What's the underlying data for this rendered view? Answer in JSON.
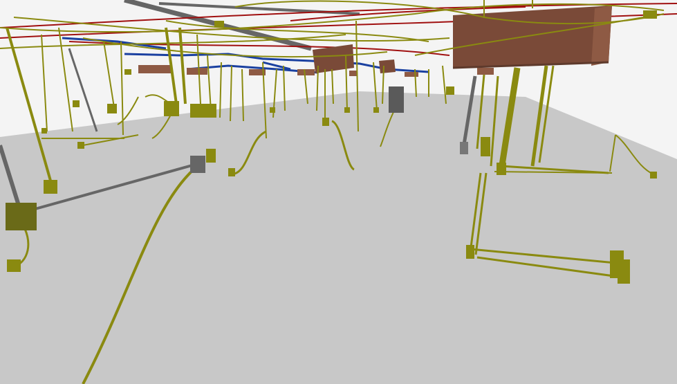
{
  "scene": {
    "description_label": "",
    "colors": {
      "background": "#f4f4f4",
      "floor": "#c8c8c8",
      "conduit": "#8a8a10",
      "conduit_dark": "#5a5a08",
      "conduit_box": "#9a9a14",
      "steel_pipe": "#666666",
      "red_pipe": "#a01010",
      "blue_pipe": "#1a40a0",
      "duct": "#7a4a38",
      "duct_light": "#8e5a44",
      "gray_box": "#5a5a5a",
      "junction": "#6a6a18"
    },
    "objects": {
      "large_duct": "ceiling-duct",
      "small_ducts": "ceiling-duct-segments",
      "conduits": "electrical-conduits",
      "junction_boxes": "junction-boxes",
      "floor_plane": "floor-plane",
      "pipes_red": "red-piping",
      "pipes_blue": "blue-piping",
      "pipes_gray": "gray-piping"
    }
  }
}
